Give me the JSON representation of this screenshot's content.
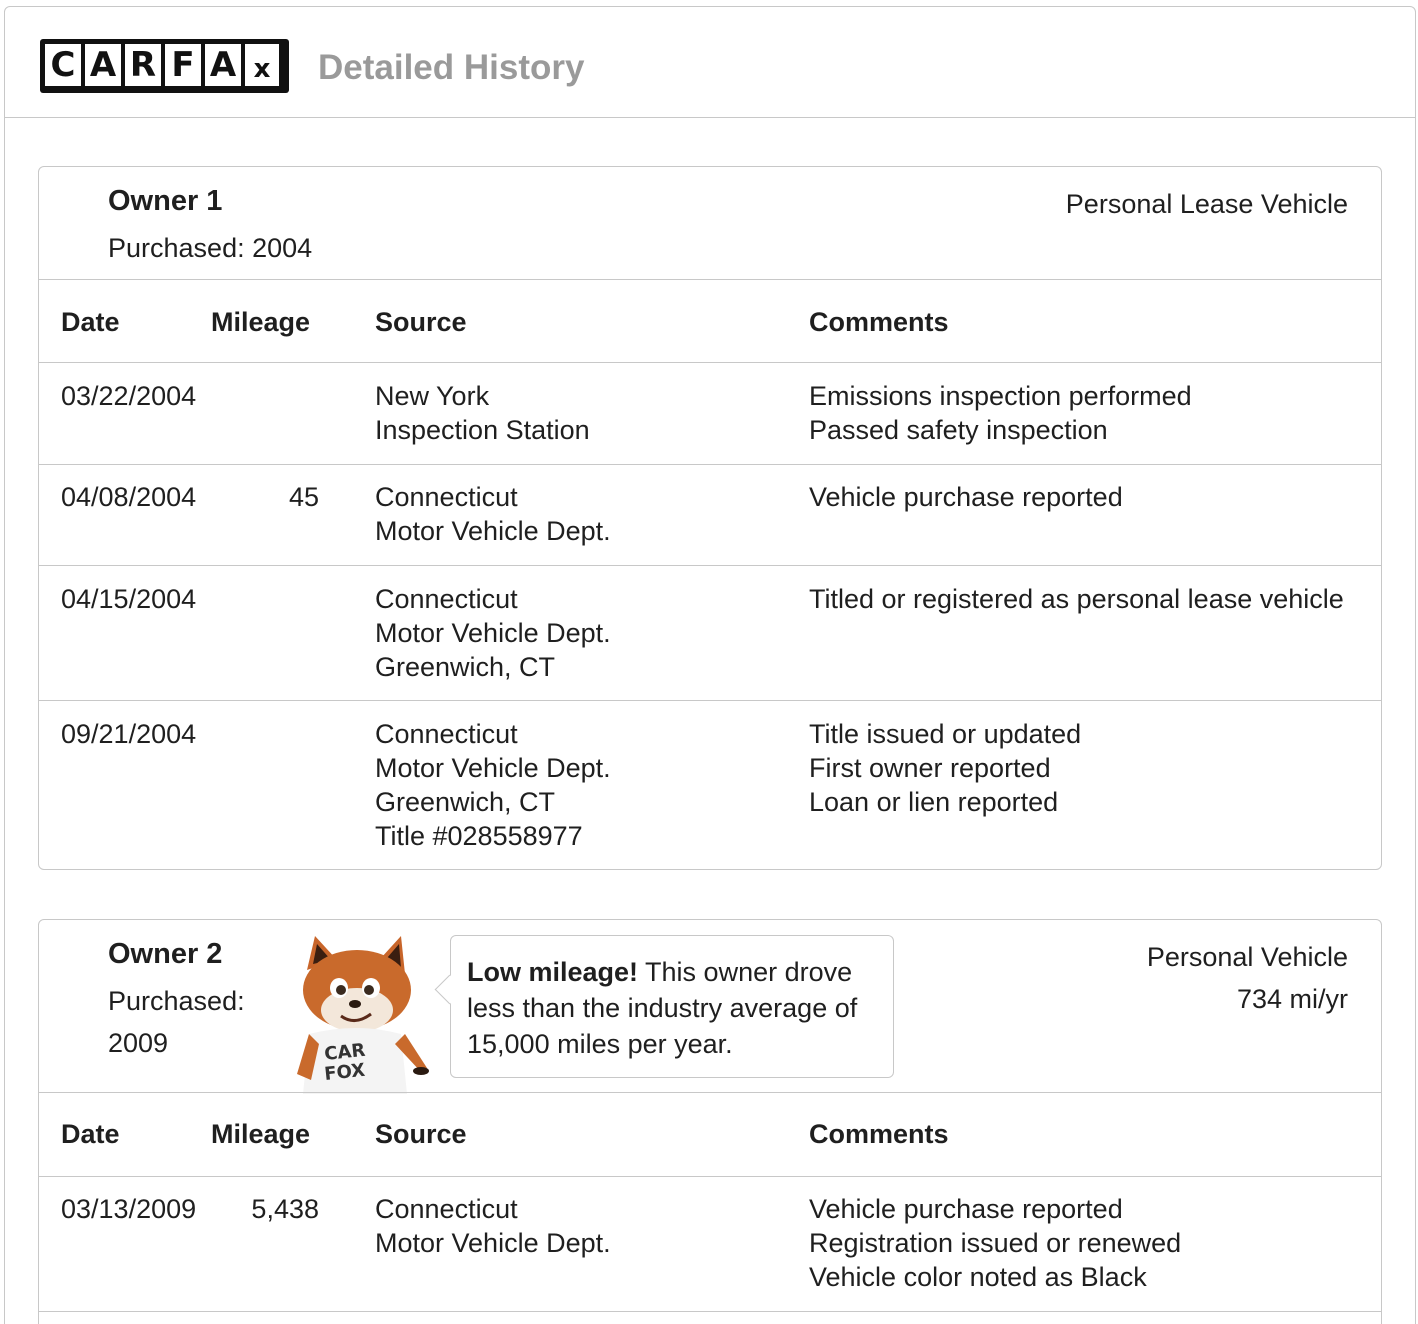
{
  "header": {
    "logo_letters": [
      "C",
      "A",
      "R",
      "F",
      "A",
      "x"
    ],
    "title": "Detailed History"
  },
  "owners": [
    {
      "title": "Owner 1",
      "purchased": "Purchased: 2004",
      "type": "Personal Lease Vehicle",
      "columns": [
        "Date",
        "Mileage",
        "Source",
        "Comments"
      ],
      "rows": [
        {
          "date": "03/22/2004",
          "mileage": "",
          "source": "New York\nInspection Station",
          "comments": "Emissions inspection performed\nPassed safety inspection"
        },
        {
          "date": "04/08/2004",
          "mileage": "45",
          "source": "Connecticut\nMotor Vehicle Dept.",
          "comments": "Vehicle purchase reported"
        },
        {
          "date": "04/15/2004",
          "mileage": "",
          "source": "Connecticut\nMotor Vehicle Dept.\nGreenwich, CT",
          "comments": "Titled or registered as personal lease vehicle"
        },
        {
          "date": "09/21/2004",
          "mileage": "",
          "source": "Connecticut\nMotor Vehicle Dept.\nGreenwich, CT\nTitle #028558977",
          "comments": "Title issued or updated\nFirst owner reported\nLoan or lien reported"
        }
      ]
    },
    {
      "title": "Owner 2",
      "purchased_label": "Purchased:",
      "purchased_year": "2009",
      "type": "Personal Vehicle",
      "miles_per_year": "734 mi/yr",
      "mascot_shirt_text": "CAR FOX",
      "callout": {
        "bold": "Low mileage!",
        "text": " This owner drove less than the industry average of 15,000 miles per year."
      },
      "columns": [
        "Date",
        "Mileage",
        "Source",
        "Comments"
      ],
      "rows": [
        {
          "date": "03/13/2009",
          "mileage": "5,438",
          "source": "Connecticut\nMotor Vehicle Dept.",
          "comments": "Vehicle purchase reported\nRegistration issued or renewed\nVehicle color noted as Black"
        }
      ]
    }
  ]
}
